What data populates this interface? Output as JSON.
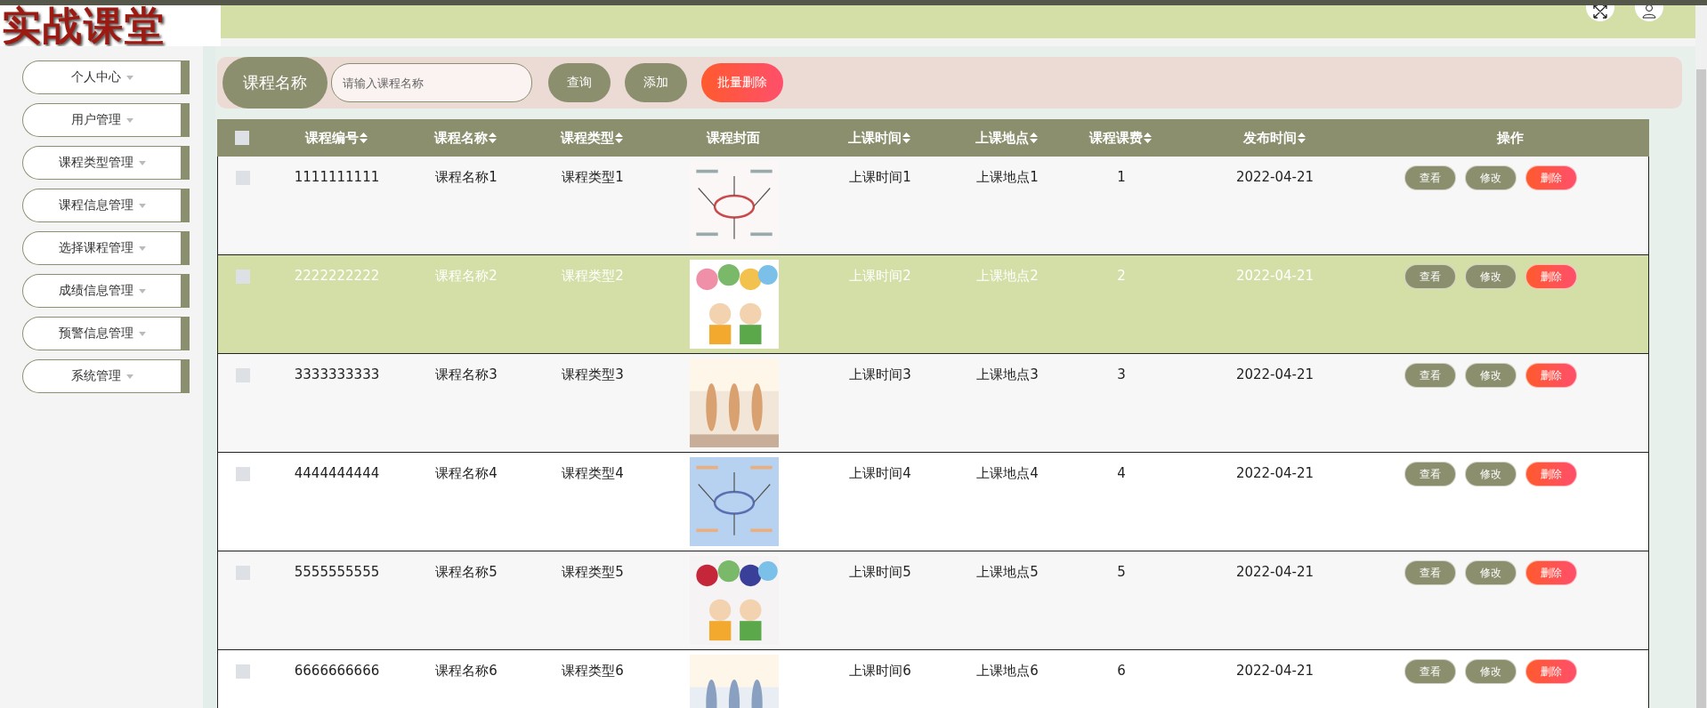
{
  "logo": {
    "title": "实战课堂"
  },
  "sidebar": {
    "items": [
      {
        "label": "个人中心"
      },
      {
        "label": "用户管理"
      },
      {
        "label": "课程类型管理"
      },
      {
        "label": "课程信息管理"
      },
      {
        "label": "选择课程管理"
      },
      {
        "label": "成绩信息管理"
      },
      {
        "label": "预警信息管理"
      },
      {
        "label": "系统管理"
      }
    ]
  },
  "search": {
    "label": "课程名称",
    "placeholder": "请输入课程名称",
    "buttons": [
      {
        "label": "查询",
        "kind": "normal"
      },
      {
        "label": "添加",
        "kind": "normal"
      },
      {
        "label": "批量删除",
        "kind": "danger"
      }
    ]
  },
  "table": {
    "all_checked": false,
    "columns": [
      {
        "label": "课程编号",
        "sortable": true
      },
      {
        "label": "课程名称",
        "sortable": true
      },
      {
        "label": "课程类型",
        "sortable": true
      },
      {
        "label": "课程封面",
        "sortable": false
      },
      {
        "label": "上课时间",
        "sortable": true
      },
      {
        "label": "上课地点",
        "sortable": true
      },
      {
        "label": "课程课费",
        "sortable": true
      },
      {
        "label": "发布时间",
        "sortable": true
      },
      {
        "label": "操作",
        "sortable": false
      }
    ],
    "rows": [
      {
        "checked": false,
        "selected": false,
        "cells": [
          "1111111111",
          "课程名称1",
          "课程类型1"
        ],
        "cover": {
          "kind": "picture"
        },
        "cells_after": [
          "上课时间1",
          "上课地点1",
          "1",
          "2022-04-21"
        ],
        "actions": [
          {
            "label": "查看",
            "kind": "normal"
          },
          {
            "label": "修改",
            "kind": "normal"
          },
          {
            "label": "删除",
            "kind": "danger"
          }
        ]
      },
      {
        "checked": false,
        "selected": true,
        "cells": [
          "2222222222",
          "课程名称2",
          "课程类型2"
        ],
        "cover": {
          "kind": "picture"
        },
        "cells_after": [
          "上课时间2",
          "上课地点2",
          "2",
          "2022-04-21"
        ],
        "actions": [
          {
            "label": "查看",
            "kind": "normal"
          },
          {
            "label": "修改",
            "kind": "normal"
          },
          {
            "label": "删除",
            "kind": "danger"
          }
        ]
      },
      {
        "checked": false,
        "selected": false,
        "cells": [
          "3333333333",
          "课程名称3",
          "课程类型3"
        ],
        "cover": {
          "kind": "picture"
        },
        "cells_after": [
          "上课时间3",
          "上课地点3",
          "3",
          "2022-04-21"
        ],
        "actions": [
          {
            "label": "查看",
            "kind": "normal"
          },
          {
            "label": "修改",
            "kind": "normal"
          },
          {
            "label": "删除",
            "kind": "danger"
          }
        ]
      },
      {
        "checked": false,
        "selected": false,
        "cells": [
          "4444444444",
          "课程名称4",
          "课程类型4"
        ],
        "cover": {
          "kind": "picture"
        },
        "cells_after": [
          "上课时间4",
          "上课地点4",
          "4",
          "2022-04-21"
        ],
        "actions": [
          {
            "label": "查看",
            "kind": "normal"
          },
          {
            "label": "修改",
            "kind": "normal"
          },
          {
            "label": "删除",
            "kind": "danger"
          }
        ]
      },
      {
        "checked": false,
        "selected": false,
        "cells": [
          "5555555555",
          "课程名称5",
          "课程类型5"
        ],
        "cover": {
          "kind": "picture"
        },
        "cells_after": [
          "上课时间5",
          "上课地点5",
          "5",
          "2022-04-21"
        ],
        "actions": [
          {
            "label": "查看",
            "kind": "normal"
          },
          {
            "label": "修改",
            "kind": "normal"
          },
          {
            "label": "删除",
            "kind": "danger"
          }
        ]
      },
      {
        "checked": false,
        "selected": false,
        "cells": [
          "6666666666",
          "课程名称6",
          "课程类型6"
        ],
        "cover": {
          "kind": "picture"
        },
        "cells_after": [
          "上课时间6",
          "上课地点6",
          "6",
          "2022-04-21"
        ],
        "actions": [
          {
            "label": "查看",
            "kind": "normal"
          },
          {
            "label": "修改",
            "kind": "normal"
          },
          {
            "label": "删除",
            "kind": "danger"
          }
        ]
      }
    ]
  }
}
